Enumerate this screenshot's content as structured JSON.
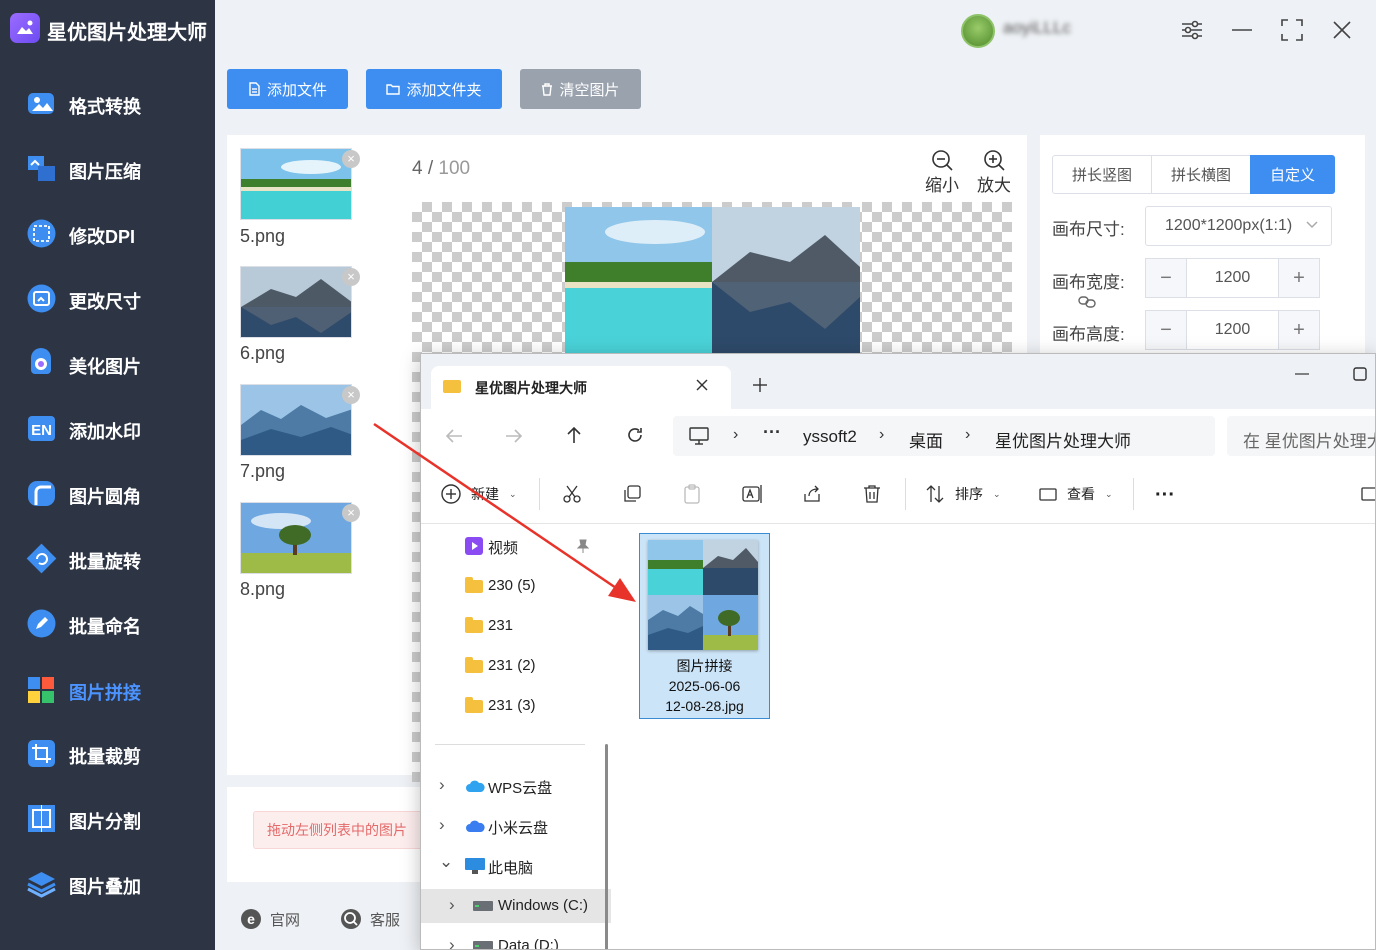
{
  "app": {
    "title": "星优图片处理大师",
    "username": "aoyiLLLc"
  },
  "sidebar": {
    "items": [
      {
        "label": "格式转换",
        "icon": "image-format-icon"
      },
      {
        "label": "图片压缩",
        "icon": "compress-icon"
      },
      {
        "label": "修改DPI",
        "icon": "dpi-icon"
      },
      {
        "label": "更改尺寸",
        "icon": "resize-icon"
      },
      {
        "label": "美化图片",
        "icon": "beautify-icon"
      },
      {
        "label": "添加水印",
        "icon": "watermark-icon"
      },
      {
        "label": "图片圆角",
        "icon": "round-corner-icon"
      },
      {
        "label": "批量旋转",
        "icon": "rotate-icon"
      },
      {
        "label": "批量命名",
        "icon": "rename-icon"
      },
      {
        "label": "图片拼接",
        "icon": "stitch-icon"
      },
      {
        "label": "批量裁剪",
        "icon": "crop-icon"
      },
      {
        "label": "图片分割",
        "icon": "split-icon"
      },
      {
        "label": "图片叠加",
        "icon": "layers-icon"
      }
    ],
    "active": "图片拼接"
  },
  "toolbar": {
    "add_file": "添加文件",
    "add_folder": "添加文件夹",
    "clear": "清空图片"
  },
  "files": [
    {
      "name": "5.png"
    },
    {
      "name": "6.png"
    },
    {
      "name": "7.png"
    },
    {
      "name": "8.png"
    }
  ],
  "preview": {
    "current": "4",
    "total": "100",
    "zoom_out": "缩小",
    "zoom_in": "放大"
  },
  "settings": {
    "modes": [
      "拼长竖图",
      "拼长横图",
      "自定义"
    ],
    "active_mode": "自定义",
    "canvas_size_label": "画布尺寸:",
    "canvas_size_value": "1200*1200px(1:1)",
    "width_label": "画布宽度:",
    "width_value": "1200",
    "height_label": "画布高度:",
    "height_value": "1200"
  },
  "hint": {
    "text": "拖动左侧列表中的图片"
  },
  "footer": {
    "website": "官网",
    "service": "客服"
  },
  "explorer": {
    "tab_title": "星优图片处理大师",
    "breadcrumb": [
      "yssoft2",
      "桌面",
      "星优图片处理大师"
    ],
    "search_placeholder": "在 星优图片处理大",
    "commands": {
      "new": "新建",
      "sort": "排序",
      "view": "查看"
    },
    "tree": [
      {
        "label": "视频",
        "icon": "video-folder-icon"
      },
      {
        "label": "230 (5)",
        "icon": "folder-icon"
      },
      {
        "label": "231",
        "icon": "folder-icon"
      },
      {
        "label": "231 (2)",
        "icon": "folder-icon"
      },
      {
        "label": "231 (3)",
        "icon": "folder-icon"
      },
      {
        "label": "WPS云盘",
        "icon": "cloud-icon"
      },
      {
        "label": "小米云盘",
        "icon": "cloud-icon"
      },
      {
        "label": "此电脑",
        "icon": "computer-icon"
      },
      {
        "label": "Windows (C:)",
        "icon": "drive-icon"
      },
      {
        "label": "Data (D:)",
        "icon": "drive-icon"
      }
    ],
    "file": {
      "line1": "图片拼接",
      "line2": "2025-06-06",
      "line3": "12-08-28.jpg"
    }
  },
  "colors": {
    "sidebar_bg": "#2d3444",
    "accent": "#3d8ef0",
    "active_label": "#4b93ff",
    "arrow": "#e8332a"
  }
}
